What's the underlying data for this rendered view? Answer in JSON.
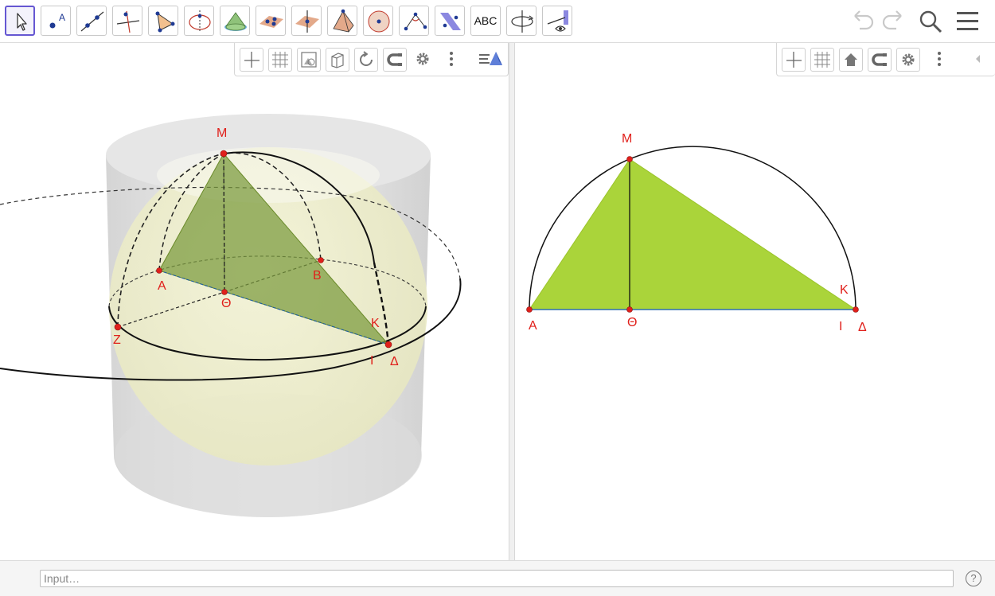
{
  "toolbar": {
    "tools": [
      {
        "name": "move-tool",
        "icon": "cursor-arrow-icon",
        "selected": true
      },
      {
        "name": "point-tool",
        "icon": "point-icon",
        "label": "A"
      },
      {
        "name": "line-tool",
        "icon": "line-through-points-icon"
      },
      {
        "name": "perpendicular-line-tool",
        "icon": "perpendicular-line-icon"
      },
      {
        "name": "polygon-tool",
        "icon": "polygon-icon"
      },
      {
        "name": "circle-tool",
        "icon": "circle-with-axis-icon"
      },
      {
        "name": "intersect-surfaces-tool",
        "icon": "cone-icon"
      },
      {
        "name": "plane-through-points-tool",
        "icon": "plane-points-icon"
      },
      {
        "name": "perpendicular-plane-tool",
        "icon": "perpendicular-plane-icon"
      },
      {
        "name": "pyramid-tool",
        "icon": "pyramid-icon"
      },
      {
        "name": "sphere-tool",
        "icon": "sphere-icon"
      },
      {
        "name": "angle-tool",
        "icon": "angle-icon"
      },
      {
        "name": "reflect-tool",
        "icon": "reflect-about-plane-icon"
      },
      {
        "name": "text-tool",
        "icon": "text-icon",
        "label": "ABC"
      },
      {
        "name": "rotate-view-tool",
        "icon": "rotate-3d-view-icon"
      },
      {
        "name": "view-in-front-tool",
        "icon": "view-in-front-of-icon"
      }
    ],
    "right": [
      "undo-icon",
      "redo-icon",
      "search-icon",
      "menu-icon"
    ]
  },
  "graphics3d": {
    "stylebar": [
      "axes-toggle-icon",
      "grid-toggle-icon",
      "clipping-box-icon",
      "projection-cube-icon",
      "rotate-view-icon",
      "point-capturing-icon",
      "settings-gear-icon",
      "more-vertical-icon",
      "view-toggle-icon"
    ],
    "labels": {
      "M": "M",
      "A": "A",
      "B": "B",
      "Theta": "Θ",
      "K": "K",
      "Z": "Z",
      "I": "Ι",
      "Delta": "Δ"
    }
  },
  "graphics2d": {
    "stylebar": [
      "axes-toggle-icon",
      "grid-toggle-icon",
      "home-icon",
      "point-capturing-icon",
      "settings-gear-icon",
      "more-vertical-icon",
      "collapse-arrow-icon"
    ],
    "labels": {
      "M": "M",
      "A": "A",
      "Theta": "Θ",
      "K": "K",
      "I": "Ι",
      "Delta": "Δ"
    }
  },
  "input": {
    "placeholder": "Input…"
  },
  "help": {
    "label": "?"
  },
  "colors": {
    "accent": "#6557d2",
    "point": "#e0201b",
    "triangle2d": "#aad43a",
    "triangle3d": "#7a9a3c",
    "sphere": "#f3f3cf"
  }
}
